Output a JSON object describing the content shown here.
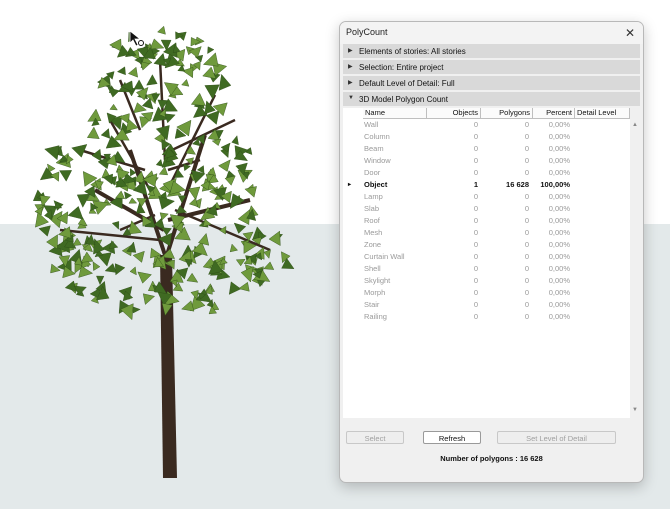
{
  "dialog": {
    "title": "PolyCount",
    "close_label": "✕",
    "sections": [
      {
        "label": "Elements of stories: All stories",
        "expanded": false
      },
      {
        "label": "Selection: Entire project",
        "expanded": false
      },
      {
        "label": "Default Level of Detail: Full",
        "expanded": false
      },
      {
        "label": "3D Model Polygon Count",
        "expanded": true
      }
    ],
    "table": {
      "headers": {
        "name": "Name",
        "objects": "Objects",
        "polygons": "Polygons",
        "percent": "Percent",
        "detail": "Detail Level"
      },
      "rows": [
        {
          "name": "Wall",
          "objects": "0",
          "polygons": "0",
          "percent": "0,00%",
          "bold": false
        },
        {
          "name": "Column",
          "objects": "0",
          "polygons": "0",
          "percent": "0,00%",
          "bold": false
        },
        {
          "name": "Beam",
          "objects": "0",
          "polygons": "0",
          "percent": "0,00%",
          "bold": false
        },
        {
          "name": "Window",
          "objects": "0",
          "polygons": "0",
          "percent": "0,00%",
          "bold": false
        },
        {
          "name": "Door",
          "objects": "0",
          "polygons": "0",
          "percent": "0,00%",
          "bold": false
        },
        {
          "name": "Object",
          "objects": "1",
          "polygons": "16 628",
          "percent": "100,00%",
          "bold": true,
          "marker": "▸"
        },
        {
          "name": "Lamp",
          "objects": "0",
          "polygons": "0",
          "percent": "0,00%",
          "bold": false
        },
        {
          "name": "Slab",
          "objects": "0",
          "polygons": "0",
          "percent": "0,00%",
          "bold": false
        },
        {
          "name": "Roof",
          "objects": "0",
          "polygons": "0",
          "percent": "0,00%",
          "bold": false
        },
        {
          "name": "Mesh",
          "objects": "0",
          "polygons": "0",
          "percent": "0,00%",
          "bold": false
        },
        {
          "name": "Zone",
          "objects": "0",
          "polygons": "0",
          "percent": "0,00%",
          "bold": false
        },
        {
          "name": "Curtain Wall",
          "objects": "0",
          "polygons": "0",
          "percent": "0,00%",
          "bold": false
        },
        {
          "name": "Shell",
          "objects": "0",
          "polygons": "0",
          "percent": "0,00%",
          "bold": false
        },
        {
          "name": "Skylight",
          "objects": "0",
          "polygons": "0",
          "percent": "0,00%",
          "bold": false
        },
        {
          "name": "Morph",
          "objects": "0",
          "polygons": "0",
          "percent": "0,00%",
          "bold": false
        },
        {
          "name": "Stair",
          "objects": "0",
          "polygons": "0",
          "percent": "0,00%",
          "bold": false
        },
        {
          "name": "Railing",
          "objects": "0",
          "polygons": "0",
          "percent": "0,00%",
          "bold": false
        }
      ]
    },
    "buttons": {
      "select": "Select",
      "refresh": "Refresh",
      "set_lod": "Set Level of Detail"
    },
    "summary": "Number of polygons : 16 628"
  },
  "colors": {
    "leaf_dark": "#3f6a22",
    "leaf_light": "#6f9a3c",
    "trunk": "#3a2a20",
    "ground": "#e3e9ea"
  }
}
